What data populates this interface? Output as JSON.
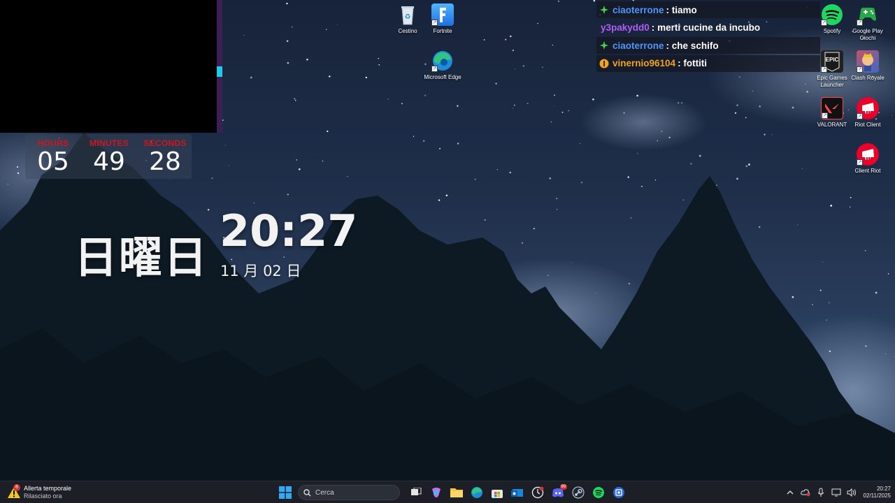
{
  "countdown": {
    "hours_label": "HOURS",
    "hours_value": "05",
    "minutes_label": "MINUTES",
    "minutes_value": "49",
    "seconds_label": "SECONDS",
    "seconds_value": "28"
  },
  "clock": {
    "weekday": "日曜日",
    "time": "20:27",
    "date": "11 月 02 日"
  },
  "chat": [
    {
      "user": "ciaoterrone",
      "separator": ":",
      "text": "tiamo",
      "user_color": "#4e95ff",
      "badge": "green-diamond-icon"
    },
    {
      "user": "y3pakydd0",
      "separator": ":",
      "text": "merti cucine da incubo",
      "user_color": "#b05cf5",
      "badge": ""
    },
    {
      "user": "ciaoterrone",
      "separator": ":",
      "text": "che schifo",
      "user_color": "#4e95ff",
      "badge": "green-diamond-icon"
    },
    {
      "user": "vinernio96104",
      "separator": ":",
      "text": "fottiti",
      "user_color": "#f0a41c",
      "badge": "gold-badge-icon"
    }
  ],
  "desktop_icons": {
    "recycle_bin": "Cestino",
    "fortnite": "Fortnite",
    "edge": "Microsoft Edge",
    "spotify": "Spotify",
    "google_play": "Google Play Giochi",
    "epic": "Epic Games Launcher",
    "epic_glyph": "EPIC",
    "clash": "Clash Royale",
    "valorant": "VALORANT",
    "riot_client": "Riot Client",
    "client_riot": "Client Riot"
  },
  "taskbar": {
    "weather_title": "Allerta temporale",
    "weather_subtitle": "Rilasciato ora",
    "weather_badge": "8",
    "search_placeholder": "Cerca",
    "discord_badge": "99",
    "tray_time": "20:27",
    "tray_date": "02/11/2025"
  },
  "colors": {
    "countdown_label": "#d2151c",
    "taskbar_bg": "#1c1f26",
    "twitch_purple": "#3b1f55"
  }
}
